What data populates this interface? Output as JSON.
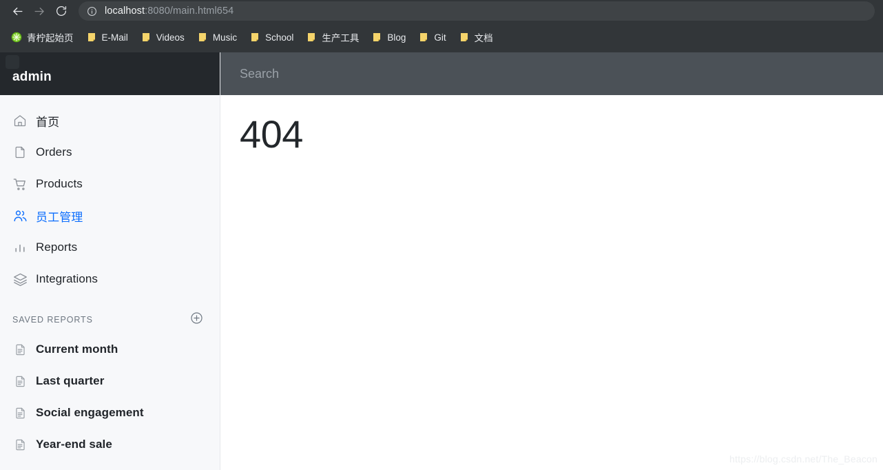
{
  "browser": {
    "back_icon": "back-arrow-icon",
    "forward_icon": "forward-arrow-icon",
    "reload_icon": "reload-icon",
    "site_info_icon": "info-circle-icon",
    "url_host": "localhost",
    "url_rest": ":8080/main.html654",
    "url_full": "localhost:8080/main.html654",
    "bookmarks": [
      {
        "label": "青柠起始页",
        "icon": "lime-favicon"
      },
      {
        "label": "E-Mail",
        "icon": "folder-icon"
      },
      {
        "label": "Videos",
        "icon": "folder-icon"
      },
      {
        "label": "Music",
        "icon": "folder-icon"
      },
      {
        "label": "School",
        "icon": "folder-icon"
      },
      {
        "label": "生产工具",
        "icon": "folder-icon"
      },
      {
        "label": "Blog",
        "icon": "folder-icon"
      },
      {
        "label": "Git",
        "icon": "folder-icon"
      },
      {
        "label": "文档",
        "icon": "folder-icon"
      }
    ]
  },
  "sidebar": {
    "brand": "admin",
    "logo_icon": "app-logo",
    "nav": [
      {
        "label": "首页",
        "icon": "home-icon",
        "active": false
      },
      {
        "label": "Orders",
        "icon": "file-icon",
        "active": false
      },
      {
        "label": "Products",
        "icon": "cart-icon",
        "active": false
      },
      {
        "label": "员工管理",
        "icon": "people-icon",
        "active": true
      },
      {
        "label": "Reports",
        "icon": "bar-chart-icon",
        "active": false
      },
      {
        "label": "Integrations",
        "icon": "layers-icon",
        "active": false
      }
    ],
    "saved_reports": {
      "title": "SAVED REPORTS",
      "add_icon": "plus-circle-icon",
      "items": [
        {
          "label": "Current month",
          "icon": "document-icon"
        },
        {
          "label": "Last quarter",
          "icon": "document-icon"
        },
        {
          "label": "Social engagement",
          "icon": "document-icon"
        },
        {
          "label": "Year-end sale",
          "icon": "document-icon"
        }
      ]
    }
  },
  "main": {
    "search_placeholder": "Search",
    "search_value": "",
    "error_code": "404",
    "watermark": "https://blog.csdn.net/The_Beacon"
  },
  "colors": {
    "chrome_bg": "#323639",
    "sidebar_header_bg": "#24282c",
    "sidebar_bg": "#f7f8fa",
    "topbar_bg": "#4b5157",
    "accent": "#0d6efd",
    "bookmark_folder": "#f5d46b",
    "lime_green": "#69c020"
  }
}
